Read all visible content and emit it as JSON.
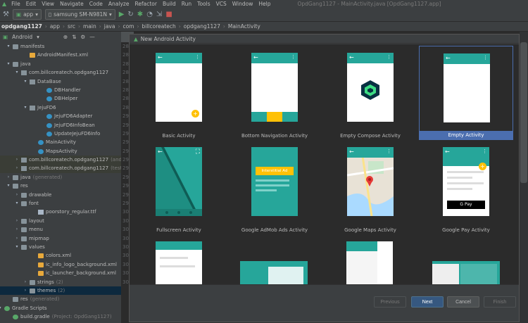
{
  "window": {
    "title": "OpdGang1127 - MainActivity.java [OpdGang1127.app]"
  },
  "menu": [
    "File",
    "Edit",
    "View",
    "Navigate",
    "Code",
    "Analyze",
    "Refactor",
    "Build",
    "Run",
    "Tools",
    "VCS",
    "Window",
    "Help"
  ],
  "toolbar": {
    "module": "app",
    "device": "samsung SM-N981N"
  },
  "breadcrumb": [
    "opdgang1127",
    "app",
    "src",
    "main",
    "java",
    "com",
    "billcoreatech",
    "opdgang1127",
    "MainActivity"
  ],
  "project": {
    "view_label": "Android"
  },
  "tree": [
    {
      "label": "manifests",
      "sub": "",
      "icon": "folder",
      "indent": 1,
      "twisty": "▾",
      "state": ""
    },
    {
      "label": "AndroidManifest.xml",
      "sub": "",
      "icon": "xml",
      "indent": 3,
      "twisty": "",
      "state": ""
    },
    {
      "label": "java",
      "sub": "",
      "icon": "folder",
      "indent": 1,
      "twisty": "▾",
      "state": ""
    },
    {
      "label": "com.billcoreatech.opdgang1127",
      "sub": "",
      "icon": "pkg",
      "indent": 2,
      "twisty": "▾",
      "state": ""
    },
    {
      "label": "DataBase",
      "sub": "",
      "icon": "pkg",
      "indent": 3,
      "twisty": "▾",
      "state": ""
    },
    {
      "label": "DBHandler",
      "sub": "",
      "icon": "cls",
      "indent": 5,
      "twisty": "",
      "state": ""
    },
    {
      "label": "DBHelper",
      "sub": "",
      "icon": "cls",
      "indent": 5,
      "twisty": "",
      "state": ""
    },
    {
      "label": "JejuFD6",
      "sub": "",
      "icon": "pkg",
      "indent": 3,
      "twisty": "▾",
      "state": ""
    },
    {
      "label": "JejuFD6Adapter",
      "sub": "",
      "icon": "cls",
      "indent": 5,
      "twisty": "",
      "state": ""
    },
    {
      "label": "JejuFD6InfoBean",
      "sub": "",
      "icon": "cls",
      "indent": 5,
      "twisty": "",
      "state": ""
    },
    {
      "label": "UpdateJejuFD6Info",
      "sub": "",
      "icon": "cls",
      "indent": 5,
      "twisty": "",
      "state": ""
    },
    {
      "label": "MainActivity",
      "sub": "",
      "icon": "cls",
      "indent": 4,
      "twisty": "",
      "state": ""
    },
    {
      "label": "MapsActivity",
      "sub": "",
      "icon": "cls",
      "indent": 4,
      "twisty": "",
      "state": ""
    },
    {
      "label": "com.billcoreatech.opdgang1127",
      "sub": "(androidTest)",
      "icon": "pkg",
      "indent": 2,
      "twisty": "›",
      "state": "hl"
    },
    {
      "label": "com.billcoreatech.opdgang1127",
      "sub": "(test)",
      "icon": "pkg",
      "indent": 2,
      "twisty": "›",
      "state": "hl"
    },
    {
      "label": "java",
      "sub": "(generated)",
      "icon": "folder",
      "indent": 1,
      "twisty": "›",
      "state": ""
    },
    {
      "label": "res",
      "sub": "",
      "icon": "folder",
      "indent": 1,
      "twisty": "▾",
      "state": ""
    },
    {
      "label": "drawable",
      "sub": "",
      "icon": "folder",
      "indent": 2,
      "twisty": "›",
      "state": ""
    },
    {
      "label": "font",
      "sub": "",
      "icon": "folder",
      "indent": 2,
      "twisty": "▾",
      "state": ""
    },
    {
      "label": "poorstory_regular.ttf",
      "sub": "",
      "icon": "file",
      "indent": 4,
      "twisty": "",
      "state": ""
    },
    {
      "label": "layout",
      "sub": "",
      "icon": "folder",
      "indent": 2,
      "twisty": "›",
      "state": ""
    },
    {
      "label": "menu",
      "sub": "",
      "icon": "folder",
      "indent": 2,
      "twisty": "›",
      "state": ""
    },
    {
      "label": "mipmap",
      "sub": "",
      "icon": "folder",
      "indent": 2,
      "twisty": "›",
      "state": ""
    },
    {
      "label": "values",
      "sub": "",
      "icon": "folder",
      "indent": 2,
      "twisty": "▾",
      "state": ""
    },
    {
      "label": "colors.xml",
      "sub": "",
      "icon": "xml",
      "indent": 4,
      "twisty": "",
      "state": ""
    },
    {
      "label": "ic_info_logo_background.xml",
      "sub": "",
      "icon": "xml",
      "indent": 4,
      "twisty": "",
      "state": ""
    },
    {
      "label": "ic_launcher_background.xml",
      "sub": "",
      "icon": "xml",
      "indent": 4,
      "twisty": "",
      "state": ""
    },
    {
      "label": "strings",
      "sub": "(2)",
      "icon": "folder",
      "indent": 3,
      "twisty": "›",
      "state": ""
    },
    {
      "label": "themes",
      "sub": "(2)",
      "icon": "folder",
      "indent": 3,
      "twisty": "›",
      "state": "sel"
    },
    {
      "label": "res",
      "sub": "(generated)",
      "icon": "folder",
      "indent": 1,
      "twisty": "",
      "state": ""
    },
    {
      "label": "Gradle Scripts",
      "sub": "",
      "icon": "gradle",
      "indent": 0,
      "twisty": "▾",
      "state": ""
    },
    {
      "label": "build.gradle",
      "sub": "(Project: OpdGang1127)",
      "icon": "gradle",
      "indent": 1,
      "twisty": "",
      "state": ""
    }
  ],
  "line_numbers": [
    "28",
    "28",
    "28",
    "28",
    "28",
    "28",
    "28",
    "28",
    "29",
    "29",
    "29",
    "29",
    "29",
    "29",
    "29",
    "29",
    "29",
    "29",
    "29",
    "30",
    "30",
    "30",
    "30",
    "30",
    "30",
    "30",
    "30",
    "30"
  ],
  "dialog": {
    "title": "New Android Activity",
    "templates": [
      {
        "name": "Basic Activity",
        "preview": "basic",
        "selected": false
      },
      {
        "name": "Bottom Navigation Activity",
        "preview": "bottomnav",
        "selected": false
      },
      {
        "name": "Empty Compose Activity",
        "preview": "compose",
        "selected": false
      },
      {
        "name": "Empty Activity",
        "preview": "empty",
        "selected": true
      },
      {
        "name": "Fullscreen Activity",
        "preview": "fullscreen",
        "selected": false
      },
      {
        "name": "Google AdMob Ads Activity",
        "preview": "admob",
        "selected": false
      },
      {
        "name": "Google Maps Activity",
        "preview": "maps",
        "selected": false
      },
      {
        "name": "Google Pay Activity",
        "preview": "pay",
        "selected": false
      }
    ],
    "admob_text": "Interstitial Ad",
    "pay_text": "G Pay",
    "buttons": {
      "previous": "Previous",
      "next": "Next",
      "cancel": "Cancel",
      "finish": "Finish"
    }
  },
  "colors": {
    "accent": "#26a69a",
    "fab": "#ffc107",
    "selection": "#4b6eaf",
    "primary_button": "#365880"
  }
}
